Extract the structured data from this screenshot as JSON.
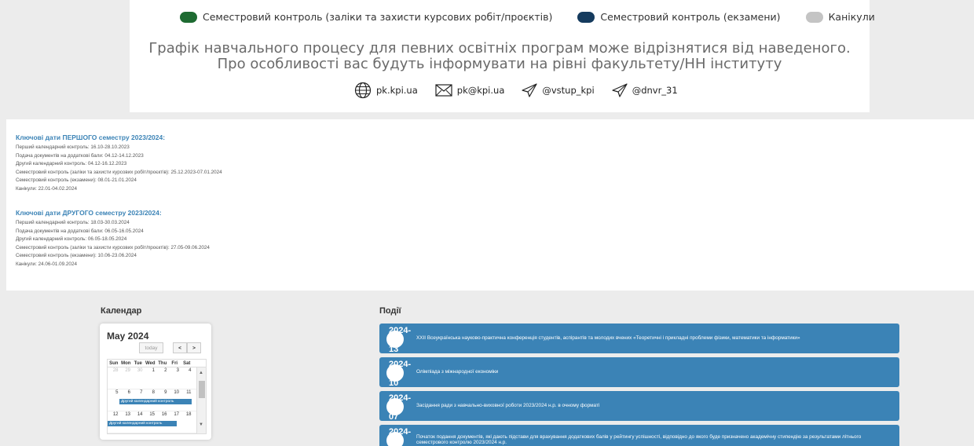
{
  "legend": [
    {
      "label": "Семестровий контроль (заліки та захисти курсових робіт/проєктів)",
      "color": "#1e6b32"
    },
    {
      "label": "Семестровий контроль (екзамени)",
      "color": "#153b5e"
    },
    {
      "label": "Канікули",
      "color": "#c4c4c4"
    }
  ],
  "notice": {
    "line1": "Графік навчального процесу для певних освітніх програм може відрізнятися від наведеного.",
    "line2": "Про особливості вас будуть інформувати на рівні факультету/НН інституту"
  },
  "contacts": {
    "website": "pk.kpi.ua",
    "email": "pk@kpi.ua",
    "telegram1": "@vstup_kpi",
    "telegram2": "@dnvr_31"
  },
  "semester1": {
    "title": "Ключові дати ПЕРШОГО семестру 2023/2024:",
    "lines": [
      "Перший календарний контроль: 16.10-28.10.2023",
      "Подача документів на додаткові бали: 04.12-14.12.2023",
      "Другий календарний контроль: 04.12-16.12.2023",
      "Семестровий контроль (заліки та захисти курсових робіт/проєктів): 25.12.2023-07.01.2024",
      "Семестровий контроль (екзамени): 08.01-21.01.2024",
      "Канікули: 22.01-04.02.2024"
    ]
  },
  "semester2": {
    "title": "Ключові дати ДРУГОГО семестру 2023/2024:",
    "lines": [
      "Перший календарний контроль: 18.03-30.03.2024",
      "Подача документів на додаткові бали: 06.05-16.05.2024",
      "Другий календарний контроль: 06.05-18.05.2024",
      "Семестровий контроль (заліки та захисти курсових робіт/проєктів): 27.05-09.06.2024",
      "Семестровий контроль (екзамени): 10.06-23.06.2024",
      "Канікули: 24.06-01.09.2024"
    ]
  },
  "calendar": {
    "section_title": "Календар",
    "month": "May 2024",
    "today_label": "today",
    "prev_label": "<",
    "next_label": ">",
    "weekdays": [
      "Sun",
      "Mon",
      "Tue",
      "Wed",
      "Thu",
      "Fri",
      "Sat"
    ],
    "weeks": [
      {
        "days": [
          "28",
          "29",
          "30",
          "1",
          "2",
          "3",
          "4"
        ],
        "muted": [
          true,
          true,
          true,
          false,
          false,
          false,
          false
        ],
        "event": ""
      },
      {
        "days": [
          "5",
          "6",
          "7",
          "8",
          "9",
          "10",
          "11"
        ],
        "muted": [
          false,
          false,
          false,
          false,
          false,
          false,
          false
        ],
        "event": "Другий календарний контроль"
      },
      {
        "days": [
          "12",
          "13",
          "14",
          "15",
          "16",
          "17",
          "18"
        ],
        "muted": [
          false,
          false,
          false,
          false,
          false,
          false,
          false
        ],
        "event": "Другий календарний контроль"
      }
    ]
  },
  "events": {
    "section_title": "Події",
    "items": [
      {
        "year": "2024-",
        "md": "05-13",
        "text": "XXII Всеукраїнська науково-практична конференція студентів, аспірантів та молодих вчених «Теоретичні і прикладні проблеми фізики, математики та інформатики»"
      },
      {
        "year": "2024-",
        "md": "05-10",
        "text": "Олімпіада з міжнародної економіки"
      },
      {
        "year": "2024-",
        "md": "05-07",
        "text": "Засідання ради з навчально-виховної роботи 2023/2024 н.р. в очному форматі"
      },
      {
        "year": "2024-",
        "md": "05-06",
        "text": "Початок подання документів, які дають підстави для врахування додаткових балів у рейтингу успішності, відповідно до якого буде призначено академічну стипендію за результатами літнього семестрового контролю 2023/2024 н.р."
      }
    ]
  }
}
